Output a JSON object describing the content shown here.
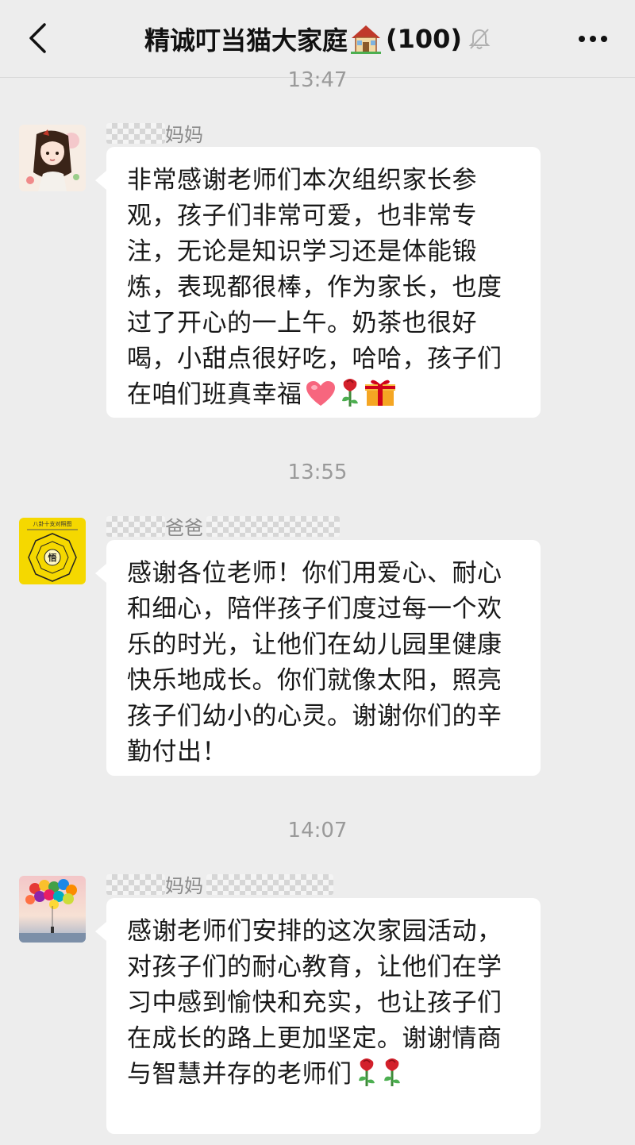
{
  "header": {
    "title": "精诚叮当猫大家庭",
    "count": "(100)",
    "house_icon": "house-icon",
    "mute_icon": "bell-muted-icon"
  },
  "messages": [
    {
      "time": "13:47",
      "sender_suffix": "妈妈",
      "avatar": "avatar-girl-illustration",
      "text": "非常感谢老师们本次组织家长参观，孩子们非常可爱，也非常专注，无论是知识学习还是体能锻炼，表现都很棒，作为家长，也度过了开心的一上午。奶茶也很好喝，小甜点很好吃，哈哈，孩子们在咱们班真幸福",
      "emojis": [
        "heart-emoji",
        "rose-emoji",
        "gift-emoji"
      ]
    },
    {
      "time": "13:55",
      "sender_suffix": "爸爸",
      "avatar": "avatar-bagua-chart",
      "avatar_text": "八卦十支对照图",
      "avatar_center": "悟",
      "text": "感谢各位老师！你们用爱心、耐心和细心，陪伴孩子们度过每一个欢乐的时光，让他们在幼儿园里健康快乐地成长。你们就像太阳，照亮孩子们幼小的心灵。谢谢你们的辛勤付出！",
      "emojis": []
    },
    {
      "time": "14:07",
      "sender_suffix": "妈妈",
      "avatar": "avatar-balloons-photo",
      "text": "感谢老师们安排的这次家园活动，对孩子们的耐心教育，让他们在学习中感到愉快和充实，也让孩子们在成长的路上更加坚定。谢谢情商与智慧并存的老师们",
      "emojis": [
        "rose-emoji",
        "rose-emoji"
      ]
    }
  ]
}
